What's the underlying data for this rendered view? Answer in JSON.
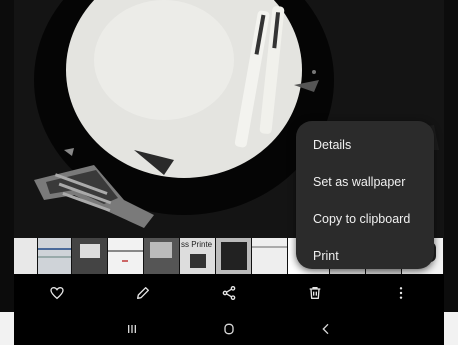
{
  "context_menu": {
    "items": [
      {
        "label": "Details"
      },
      {
        "label": "Set as wallpaper"
      },
      {
        "label": "Copy to clipboard"
      },
      {
        "label": "Print"
      }
    ]
  },
  "filmstrip": {
    "thumb_text": "ss Printe"
  },
  "toolbar": {
    "favorite_icon": "heart-icon",
    "edit_icon": "pencil-icon",
    "share_icon": "share-icon",
    "delete_icon": "trash-icon",
    "more_icon": "more-vertical-icon"
  },
  "navbar": {
    "recents_icon": "recents-icon",
    "home_icon": "home-icon",
    "back_icon": "back-icon"
  },
  "colors": {
    "menu_bg": "#2b2b2b",
    "menu_text": "#f0f0f0",
    "toolbar_bg": "#000000",
    "icon": "#e6e6e6"
  }
}
